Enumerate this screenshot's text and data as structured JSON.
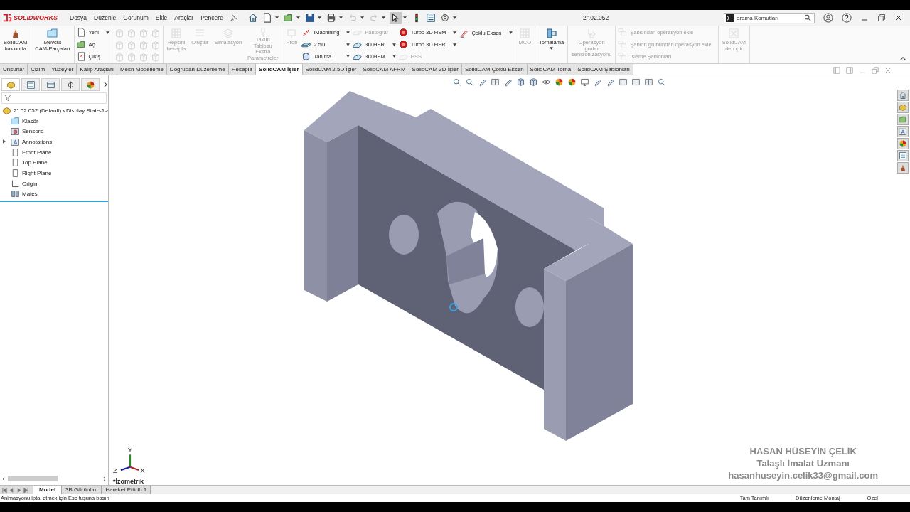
{
  "title_bar": {
    "logo": "SOLIDWORKS",
    "menu": [
      "Dosya",
      "Düzenle",
      "Görünüm",
      "Ekle",
      "Araçlar",
      "Pencere"
    ],
    "quick_access": [
      {
        "kind": "home",
        "disabled": false,
        "selected": false,
        "dropdown": false
      },
      {
        "kind": "new",
        "disabled": false,
        "selected": false,
        "dropdown": true
      },
      {
        "kind": "open",
        "disabled": false,
        "selected": false,
        "dropdown": true
      },
      {
        "kind": "save",
        "disabled": false,
        "selected": false,
        "dropdown": true
      },
      {
        "kind": "print",
        "disabled": false,
        "selected": false,
        "dropdown": true
      },
      {
        "kind": "undo",
        "disabled": true,
        "selected": false,
        "dropdown": true
      },
      {
        "kind": "redo",
        "disabled": true,
        "selected": false,
        "dropdown": true
      },
      {
        "kind": "pointer",
        "disabled": false,
        "selected": true,
        "dropdown": true
      },
      {
        "kind": "light",
        "disabled": false,
        "selected": false,
        "dropdown": false
      },
      {
        "kind": "list",
        "disabled": false,
        "selected": false,
        "dropdown": false
      },
      {
        "kind": "gear",
        "disabled": false,
        "selected": false,
        "dropdown": true
      }
    ],
    "document_title": "2''.02.052",
    "search": {
      "placeholder": "arama Komutları"
    }
  },
  "ribbon": [
    {
      "columns": [
        {
          "kind": "large",
          "label": "SolidCAM\nhakkında",
          "disabled": false,
          "dropdown": false
        }
      ]
    },
    {
      "columns": [
        {
          "kind": "large",
          "label": "Mevcut\nCAM-Parçaları",
          "disabled": false,
          "dropdown": false
        }
      ]
    },
    {
      "columns": [
        {
          "kind": "stack",
          "items": [
            {
              "label": "Yeni",
              "disabled": false,
              "dropdown": true
            },
            {
              "label": "Aç",
              "disabled": false,
              "dropdown": false
            },
            {
              "label": "Çıkış",
              "disabled": false,
              "dropdown": false
            }
          ]
        }
      ]
    },
    {
      "columns": [
        {
          "kind": "icon_grid",
          "disabled": true
        }
      ]
    },
    {
      "columns": [
        {
          "kind": "large",
          "label": "Hepsini\nhesapla",
          "disabled": true,
          "dropdown": false
        },
        {
          "kind": "large",
          "label": "Oluştur",
          "disabled": true,
          "dropdown": false
        },
        {
          "kind": "large",
          "label": "Simülasyon",
          "disabled": true,
          "dropdown": false
        },
        {
          "kind": "large",
          "label": "Takım\nTablosu\nEkstra\nParametreler",
          "disabled": true,
          "dropdown": false
        }
      ]
    },
    {
      "columns": [
        {
          "kind": "large",
          "label": "Prob",
          "disabled": true,
          "dropdown": false
        },
        {
          "kind": "stack",
          "items": [
            {
              "label": "iMachining",
              "disabled": false,
              "dropdown": true
            },
            {
              "label": "2.5D",
              "disabled": false,
              "dropdown": true
            },
            {
              "label": "Tanıma",
              "disabled": false,
              "dropdown": true
            }
          ]
        },
        {
          "kind": "stack",
          "items": [
            {
              "label": "Pantograf",
              "disabled": true,
              "dropdown": false
            },
            {
              "label": "3D HSR",
              "disabled": false,
              "dropdown": true
            },
            {
              "label": "3D HSM",
              "disabled": false,
              "dropdown": true
            }
          ]
        },
        {
          "kind": "stack",
          "items": [
            {
              "label": "Turbo 3D HSM",
              "disabled": false,
              "dropdown": true
            },
            {
              "label": "Turbo 3D HSR",
              "disabled": false,
              "dropdown": true
            },
            {
              "label": "HSS",
              "disabled": true,
              "dropdown": false
            }
          ]
        },
        {
          "kind": "stack",
          "items": [
            {
              "label": "Çoklu Eksen",
              "disabled": false,
              "dropdown": true
            }
          ]
        }
      ]
    },
    {
      "columns": [
        {
          "kind": "large",
          "label": "MCO",
          "disabled": true,
          "dropdown": false
        }
      ]
    },
    {
      "columns": [
        {
          "kind": "large",
          "label": "Tornalama",
          "disabled": false,
          "dropdown": true
        }
      ]
    },
    {
      "columns": [
        {
          "kind": "large",
          "label": "Operasyon\ngrubu\nsenkronizasyonu",
          "disabled": true,
          "dropdown": false
        }
      ]
    },
    {
      "columns": [
        {
          "kind": "stack",
          "items": [
            {
              "label": "Şablondan operasyon ekle",
              "disabled": true,
              "dropdown": false
            },
            {
              "label": "Şablon grubundan operasyon ekle",
              "disabled": true,
              "dropdown": false
            },
            {
              "label": "İşleme Şablonları",
              "disabled": true,
              "dropdown": false
            }
          ]
        }
      ]
    },
    {
      "columns": [
        {
          "kind": "large",
          "label": "SolidCAM\nden çık",
          "disabled": true,
          "dropdown": false
        }
      ]
    }
  ],
  "command_tabs": [
    {
      "label": "Unsurlar",
      "selected": false
    },
    {
      "label": "Çizim",
      "selected": false
    },
    {
      "label": "Yüzeyler",
      "selected": false
    },
    {
      "label": "Kalıp Araçları",
      "selected": false
    },
    {
      "label": "Mesh Modelleme",
      "selected": false
    },
    {
      "label": "Doğrudan Düzenleme",
      "selected": false
    },
    {
      "label": "Hesapla",
      "selected": false
    },
    {
      "label": "SolidCAM İşler",
      "selected": true
    },
    {
      "label": "SolidCAM 2.5D İşler",
      "selected": false
    },
    {
      "label": "SolidCAM AFRM",
      "selected": false
    },
    {
      "label": "SolidCAM 3D İşler",
      "selected": false
    },
    {
      "label": "SolidCAM Çoklu Eksen",
      "selected": false
    },
    {
      "label": "SolidCAM Torna",
      "selected": false
    },
    {
      "label": "SolidCAM Şablonları",
      "selected": false
    }
  ],
  "panel_tabs": [
    {
      "kind": "part",
      "selected": true
    },
    {
      "kind": "list",
      "selected": false
    },
    {
      "kind": "views",
      "selected": false
    },
    {
      "kind": "target",
      "selected": false
    },
    {
      "kind": "ball",
      "selected": false
    }
  ],
  "feature_tree": {
    "root": {
      "label": "2''.02.052 (Default) <Display State-1>",
      "children": [
        {
          "kind": "folder",
          "label": "Klasör"
        },
        {
          "kind": "sensor",
          "label": "Sensors"
        },
        {
          "kind": "annotation",
          "label": "Annotations",
          "collapsed": true
        },
        {
          "kind": "plane",
          "label": "Front Plane"
        },
        {
          "kind": "plane",
          "label": "Top Plane"
        },
        {
          "kind": "plane",
          "label": "Right Plane"
        },
        {
          "kind": "origin",
          "label": "Origin"
        },
        {
          "kind": "mates",
          "label": "Mates"
        }
      ]
    }
  },
  "viewport": {
    "triad": {
      "x": "X",
      "y": "Y",
      "z": "Z"
    },
    "view_name": "*İzometrik",
    "overlay": [
      "HASAN HÜSEYİN ÇELİK",
      "Talaşlı İmalat Uzmanı",
      "hasanhuseyin.celik33@gmail.com"
    ]
  },
  "bottom_tabs": [
    {
      "label": "Model",
      "selected": true
    },
    {
      "label": "3B Görünüm",
      "selected": false
    },
    {
      "label": "Hareket Etüdü 1",
      "selected": false
    }
  ],
  "status_bar": {
    "message": "Animasyonu iptal etmek için Esc tuşuna basın",
    "fields": [
      "Tam Tanımlı",
      "Düzenleme Montaj",
      "Özel"
    ]
  }
}
